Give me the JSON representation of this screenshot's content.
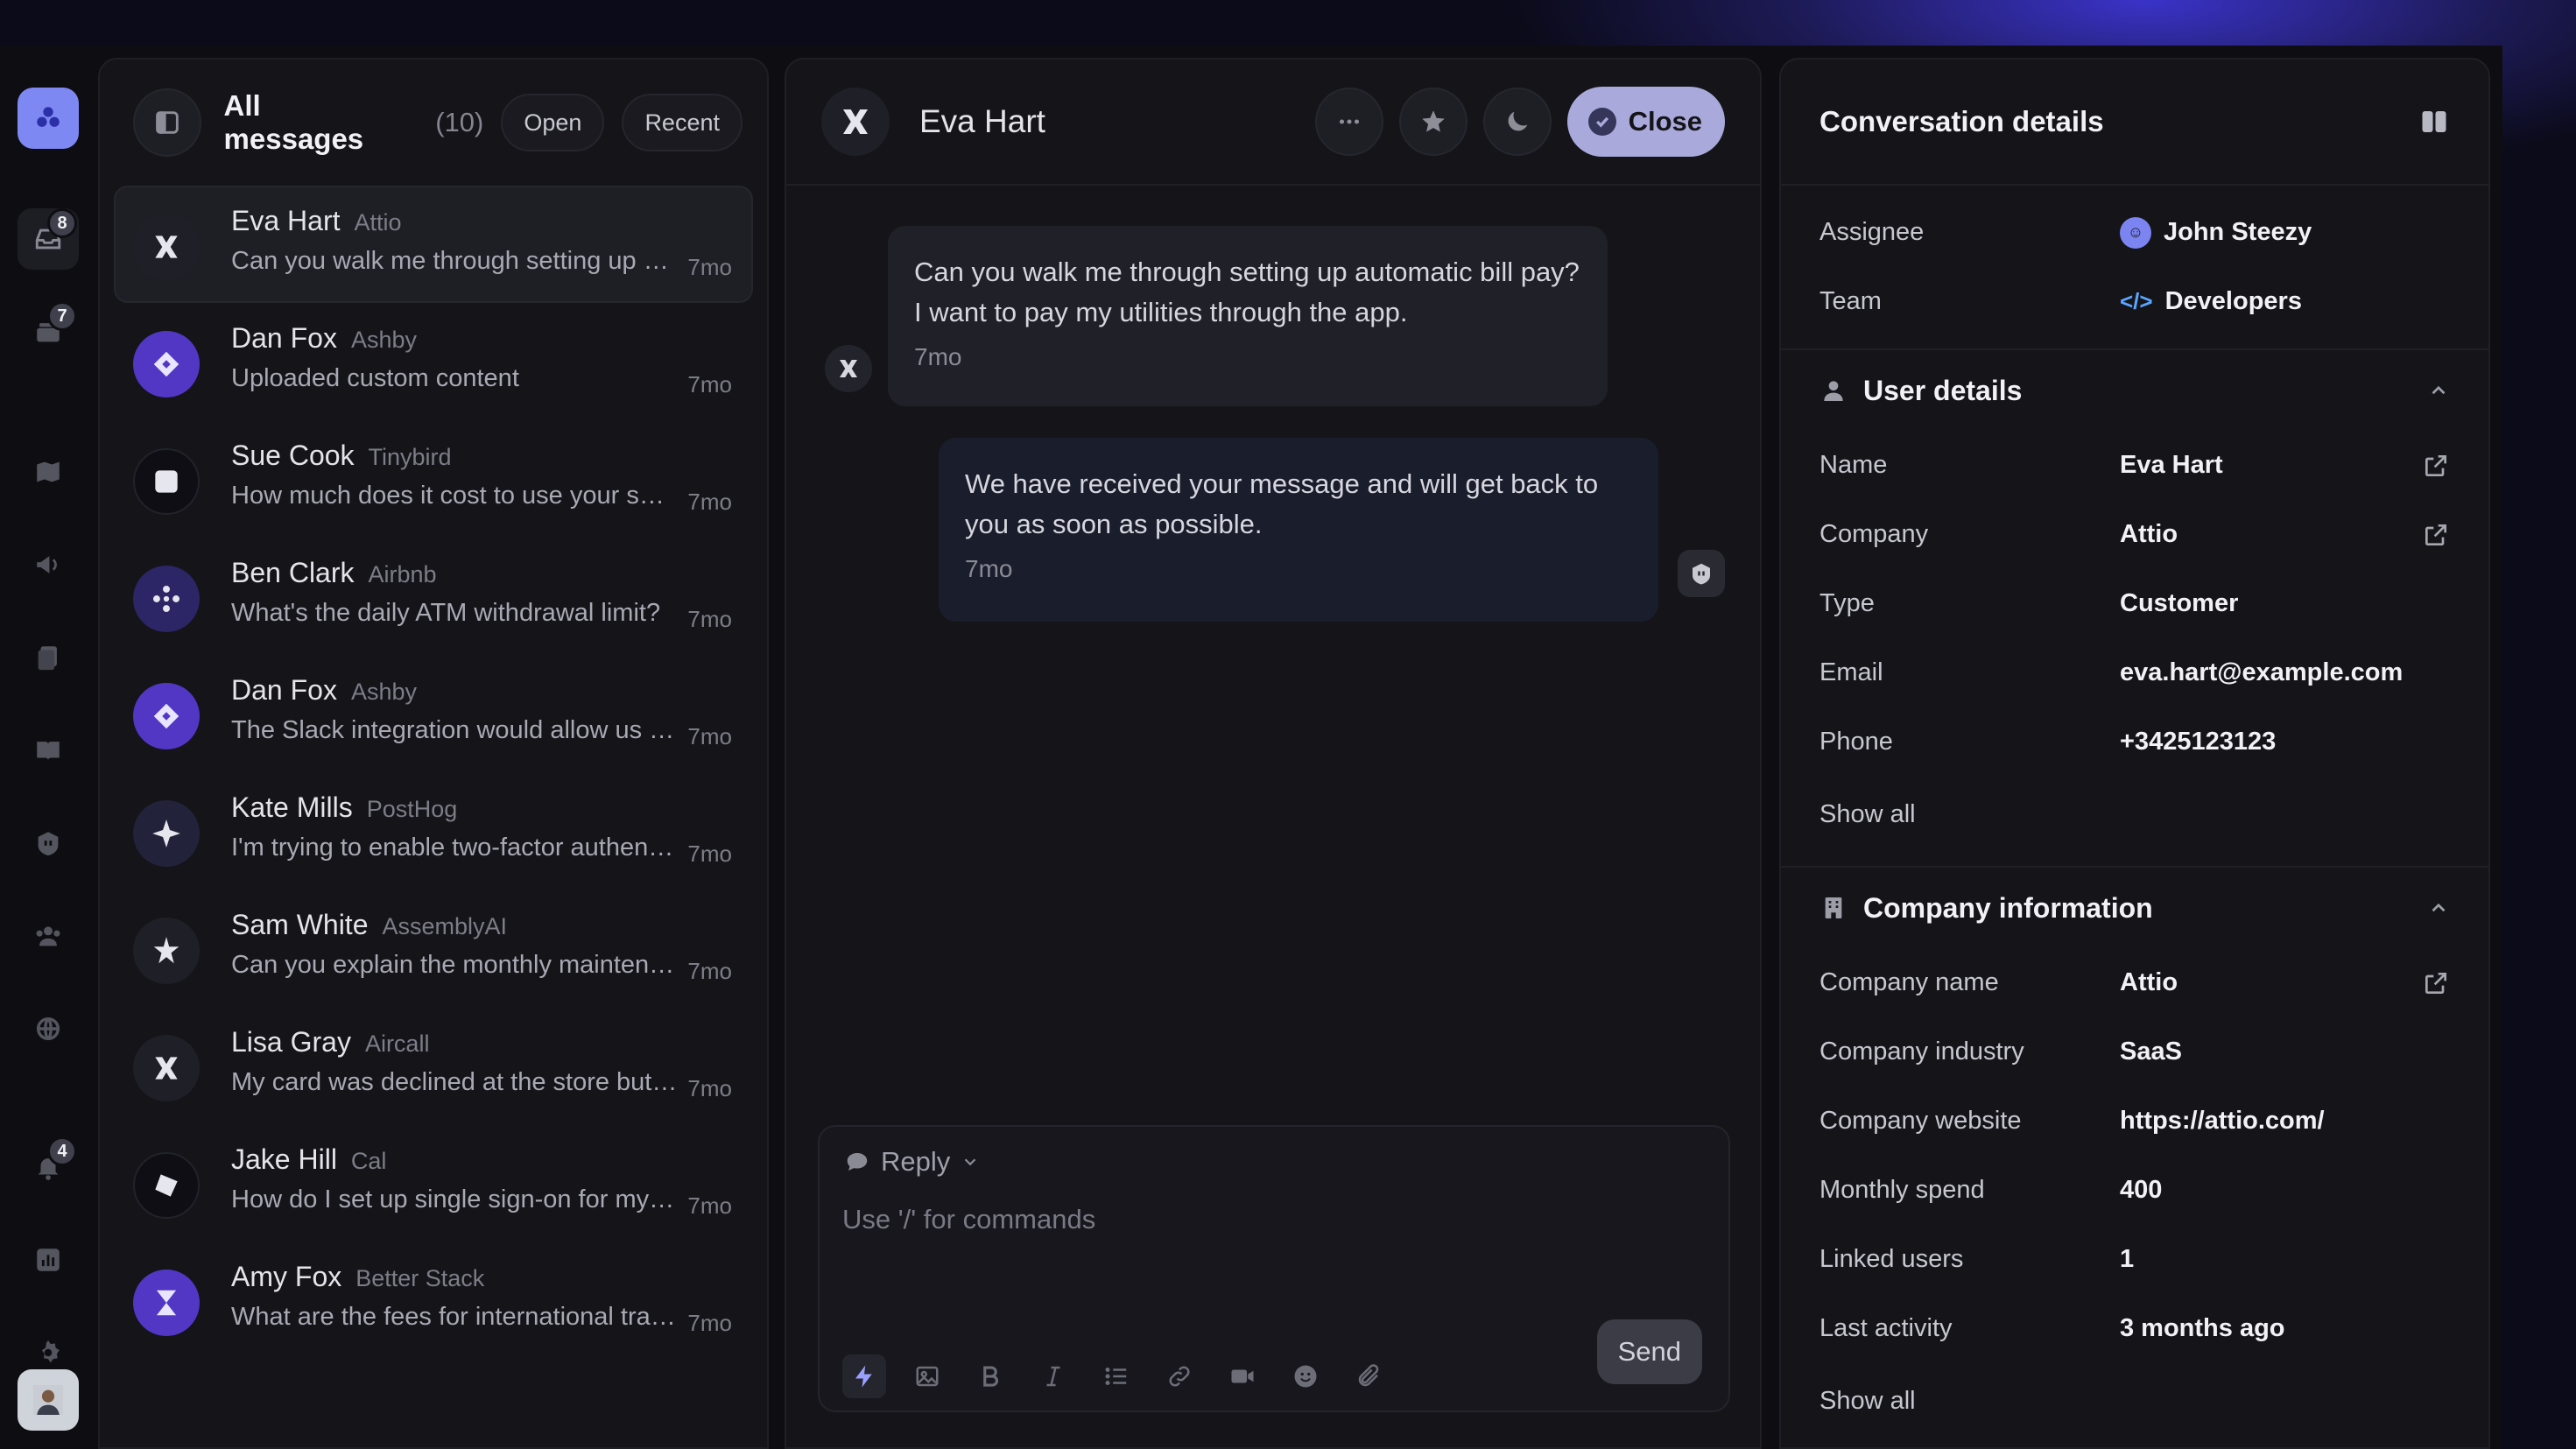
{
  "rail": {
    "badges": {
      "inbox": "8",
      "tickets": "7",
      "notifications": "4"
    }
  },
  "list": {
    "title": "All messages",
    "count": "(10)",
    "filter_status": "Open",
    "filter_sort": "Recent",
    "conversations": [
      {
        "name": "Eva Hart",
        "company": "Attio",
        "preview": "Can you walk me through setting up automatic bill pay? I want to pay my utilities through the app.",
        "time": "7mo"
      },
      {
        "name": "Dan Fox",
        "company": "Ashby",
        "preview": "Uploaded custom content",
        "time": "7mo"
      },
      {
        "name": "Sue Cook",
        "company": "Tinybird",
        "preview": "How much does it cost to use your service?",
        "time": "7mo"
      },
      {
        "name": "Ben Clark",
        "company": "Airbnb",
        "preview": "What's the daily ATM withdrawal limit?",
        "time": "7mo"
      },
      {
        "name": "Dan Fox",
        "company": "Ashby",
        "preview": "The Slack integration would allow us to get notified",
        "time": "7mo"
      },
      {
        "name": "Kate Mills",
        "company": "PostHog",
        "preview": "I'm trying to enable two-factor authentication",
        "time": "7mo"
      },
      {
        "name": "Sam White",
        "company": "AssemblyAI",
        "preview": "Can you explain the monthly maintenance fee?",
        "time": "7mo"
      },
      {
        "name": "Lisa Gray",
        "company": "Aircall",
        "preview": "My card was declined at the store but I have funds",
        "time": "7mo"
      },
      {
        "name": "Jake Hill",
        "company": "Cal",
        "preview": "How do I set up single sign-on for my team?",
        "time": "7mo"
      },
      {
        "name": "Amy Fox",
        "company": "Better Stack",
        "preview": "What are the fees for international transfers?",
        "time": "7mo"
      }
    ]
  },
  "chat": {
    "contact_name": "Eva Hart",
    "close_label": "Close",
    "messages": [
      {
        "text": "Can you walk me through setting up automatic bill pay? I want to pay my utilities through the app.",
        "time": "7mo"
      },
      {
        "text": "We have received your message and will get back to you as soon as possible.",
        "time": "7mo"
      }
    ],
    "composer": {
      "mode": "Reply",
      "placeholder": "Use '/' for commands",
      "send_label": "Send"
    }
  },
  "details": {
    "title": "Conversation details",
    "assignee_label": "Assignee",
    "assignee_value": "John Steezy",
    "team_label": "Team",
    "team_value": "Developers",
    "user_section": "User details",
    "user_fields": [
      {
        "label": "Name",
        "value": "Eva Hart"
      },
      {
        "label": "Company",
        "value": "Attio"
      },
      {
        "label": "Type",
        "value": "Customer"
      },
      {
        "label": "Email",
        "value": "eva.hart@example.com"
      },
      {
        "label": "Phone",
        "value": "+3425123123"
      }
    ],
    "show_all": "Show all",
    "company_section": "Company information",
    "company_fields": [
      {
        "label": "Company name",
        "value": "Attio"
      },
      {
        "label": "Company industry",
        "value": "SaaS"
      },
      {
        "label": "Company website",
        "value": "https://attio.com/"
      },
      {
        "label": "Monthly spend",
        "value": "400"
      },
      {
        "label": "Linked users",
        "value": "1"
      },
      {
        "label": "Last activity",
        "value": "3 months ago"
      }
    ],
    "show_all_2": "Show all"
  }
}
